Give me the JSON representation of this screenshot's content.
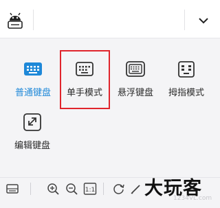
{
  "header": {
    "logo_icon": "android-robot-keyboard-icon",
    "menu_icon": "chevron-down-icon"
  },
  "modes": [
    {
      "label": "普通键盘",
      "icon": "keyboard-icon",
      "active": true
    },
    {
      "label": "单手模式",
      "icon": "keyboard-icon",
      "active": false,
      "highlighted": true
    },
    {
      "label": "悬浮键盘",
      "icon": "floating-keyboard-icon",
      "active": false
    },
    {
      "label": "拇指模式",
      "icon": "split-keyboard-icon",
      "active": false
    },
    {
      "label": "编辑键盘",
      "icon": "edit-keyboard-icon",
      "active": false
    }
  ],
  "toolbar": {
    "items": [
      "keyboard-icon",
      "zoom-in-icon",
      "zoom-out-icon",
      "ratio-icon",
      "refresh-icon",
      "pencil-icon"
    ],
    "ratio_label": "1:1"
  },
  "watermark": {
    "text": "大玩客",
    "sub": "1234VL.com"
  },
  "colors": {
    "accent": "#1e88d8",
    "highlight": "#e0242c"
  }
}
